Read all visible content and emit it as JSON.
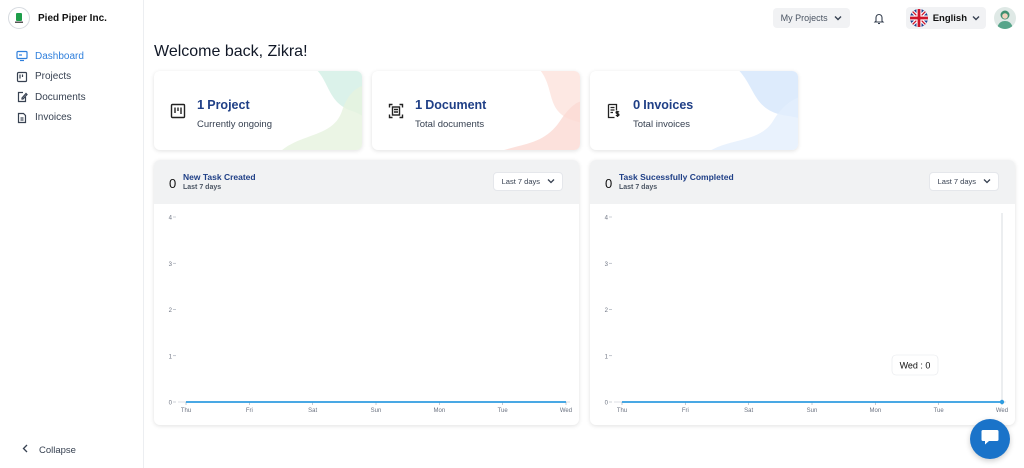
{
  "brand": {
    "name": "Pied Piper Inc."
  },
  "sidebar": {
    "items": [
      {
        "label": "Dashboard",
        "icon": "monitor-icon",
        "active": true
      },
      {
        "label": "Projects",
        "icon": "kanban-icon"
      },
      {
        "label": "Documents",
        "icon": "edit-doc-icon"
      },
      {
        "label": "Invoices",
        "icon": "invoice-icon"
      }
    ],
    "collapse_label": "Collapse"
  },
  "topbar": {
    "projects_label": "My Projects",
    "language": "English"
  },
  "welcome": "Welcome back, Zikra!",
  "stats": [
    {
      "count": "1",
      "label": "Project",
      "sub": "Currently ongoing",
      "accent": "#cfeee3"
    },
    {
      "count": "1",
      "label": "Document",
      "sub": "Total documents",
      "accent": "#fbd9d3"
    },
    {
      "count": "0",
      "label": "Invoices",
      "sub": "Total invoices",
      "accent": "#d4e6fb"
    }
  ],
  "tasks": [
    {
      "count": "0",
      "title": "New Task Created",
      "period": "Last 7 days",
      "filter": "Last 7 days",
      "chart_data": {
        "type": "area",
        "categories": [
          "Thu",
          "Fri",
          "Sat",
          "Sun",
          "Mon",
          "Tue",
          "Wed"
        ],
        "values": [
          0,
          0,
          0,
          0,
          0,
          0,
          0
        ],
        "ylim": [
          0,
          4
        ],
        "yticks": [
          "0",
          "1",
          "2",
          "3",
          "4"
        ],
        "color": "#2f9ce0"
      }
    },
    {
      "count": "0",
      "title": "Task Sucessfully Completed",
      "period": "Last 7 days",
      "filter": "Last 7 days",
      "tooltip": "Wed : 0",
      "chart_data": {
        "type": "area",
        "categories": [
          "Thu",
          "Fri",
          "Sat",
          "Sun",
          "Mon",
          "Tue",
          "Wed"
        ],
        "values": [
          0,
          0,
          0,
          0,
          0,
          0,
          0
        ],
        "ylim": [
          0,
          4
        ],
        "yticks": [
          "0",
          "1",
          "2",
          "3",
          "4"
        ],
        "color": "#2f9ce0"
      }
    }
  ]
}
